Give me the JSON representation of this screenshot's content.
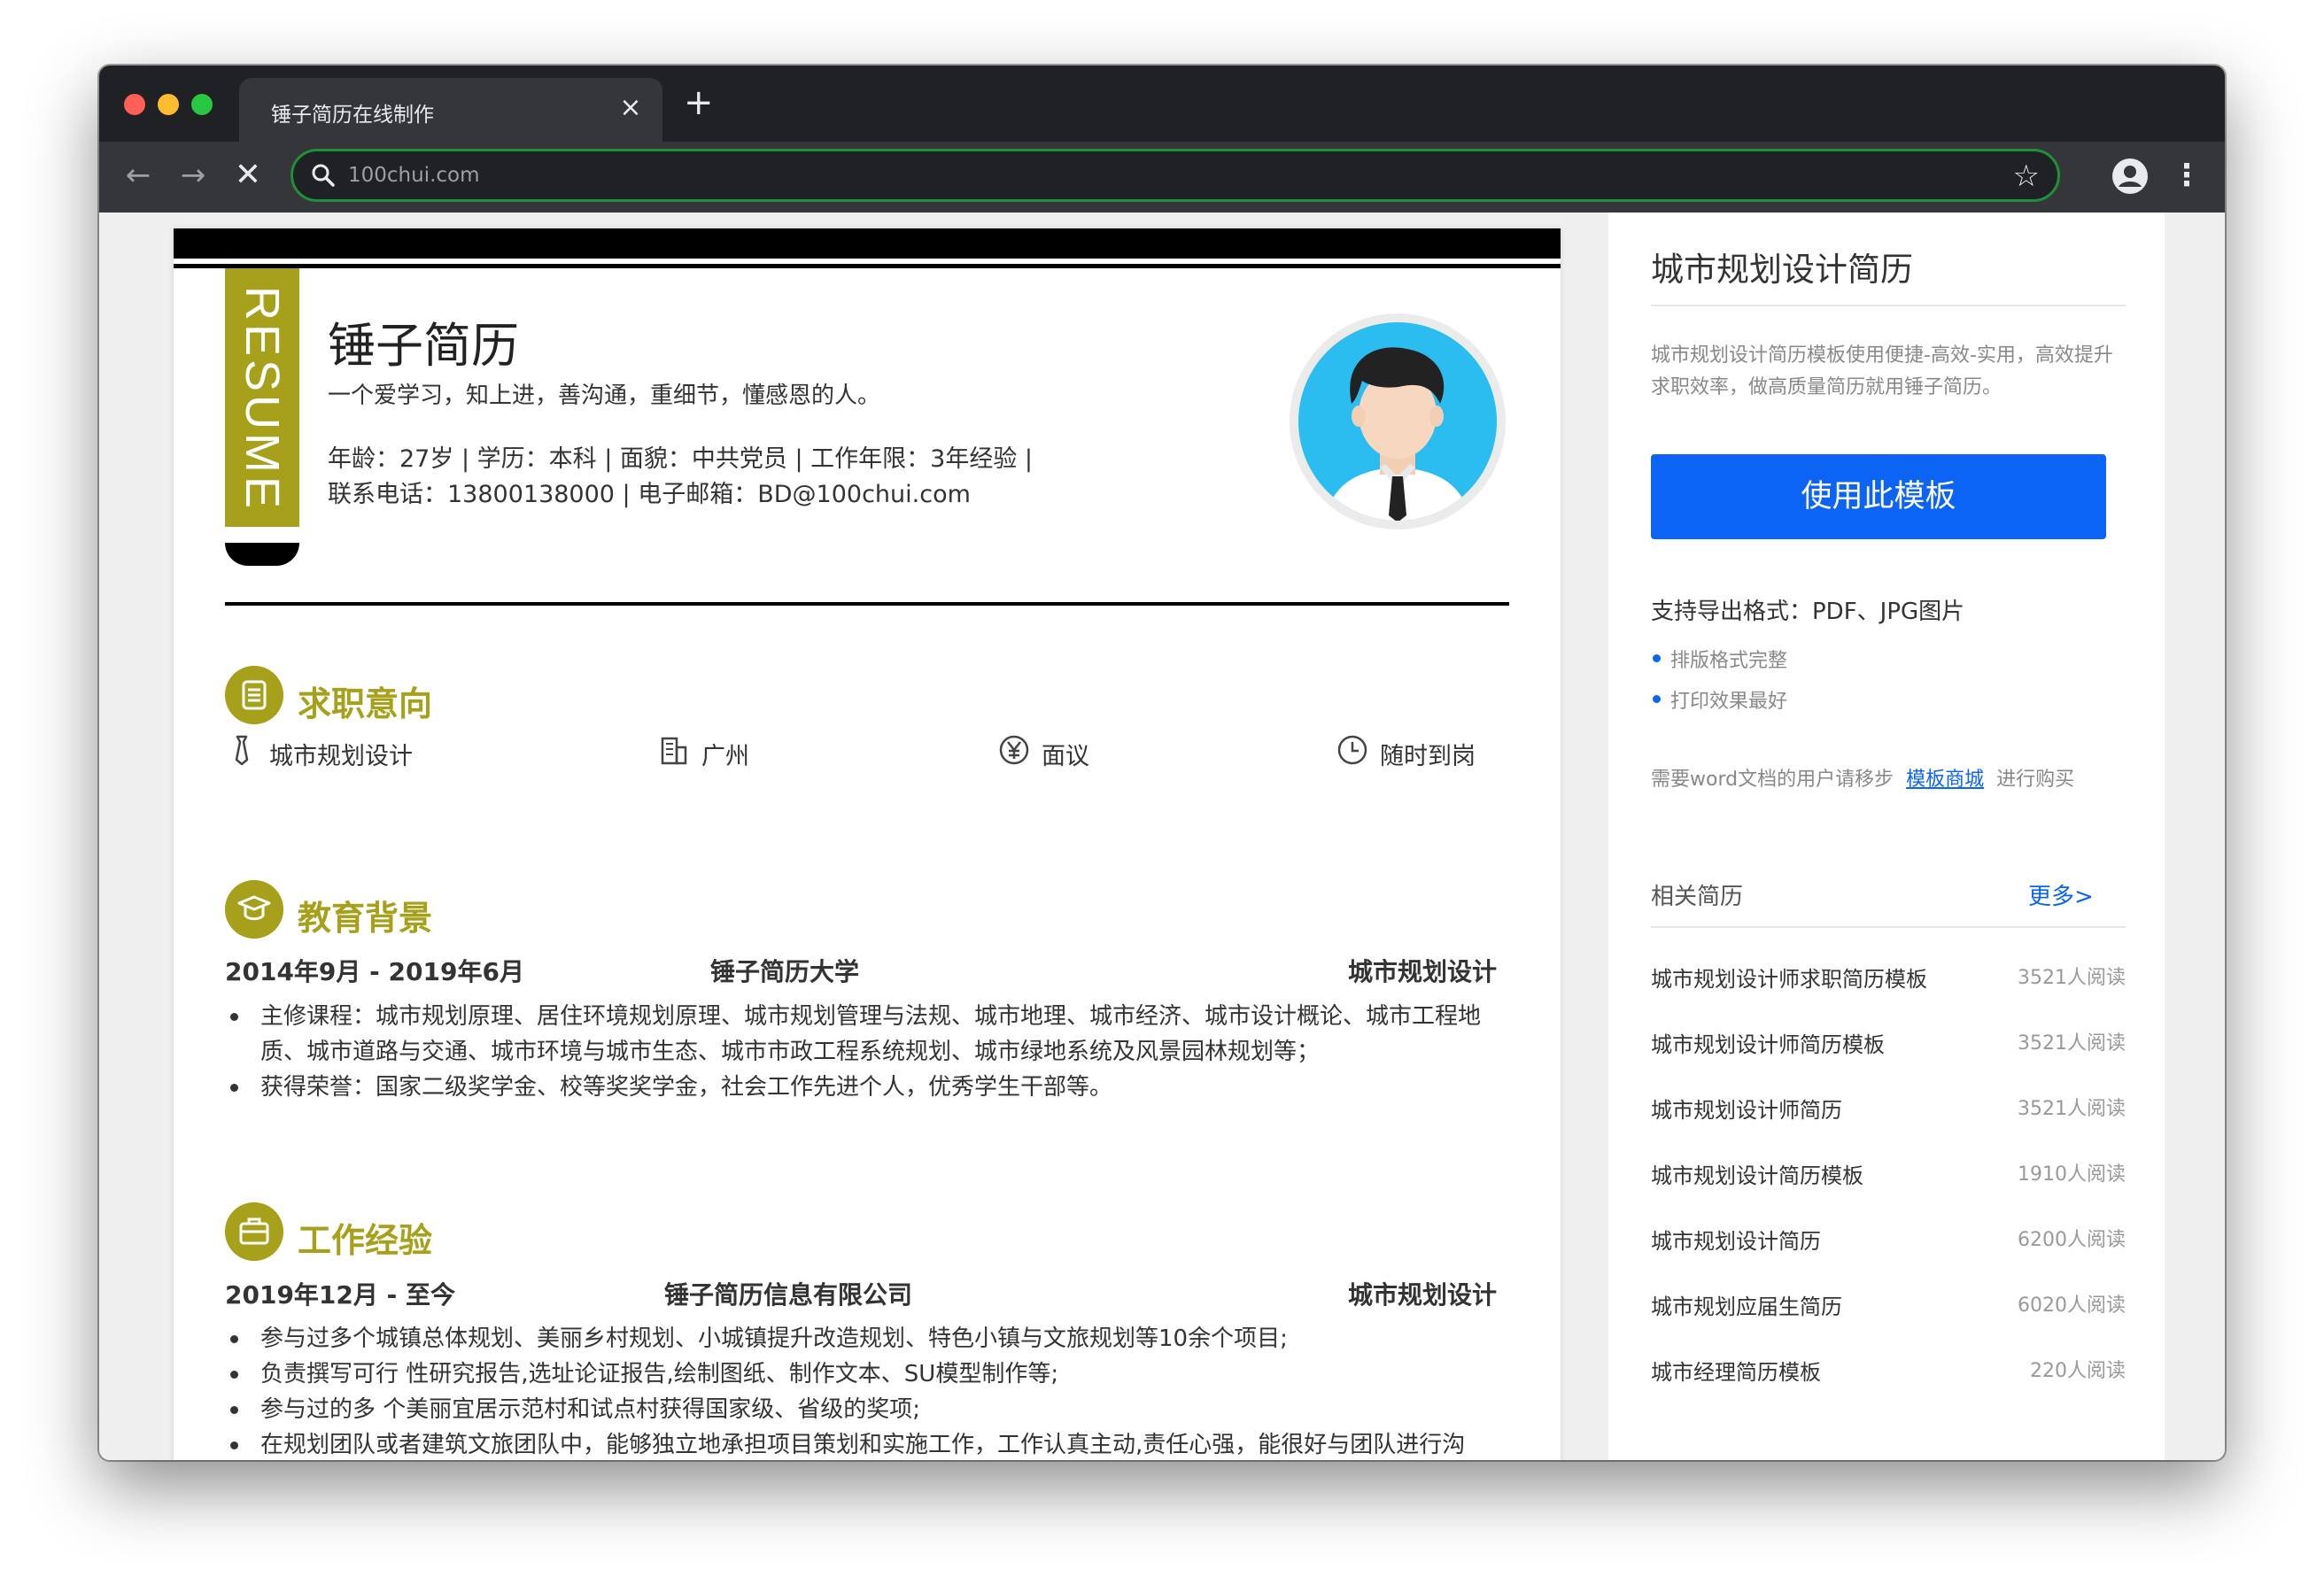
{
  "browser": {
    "tab_title": "锤子简历在线制作",
    "tab_close": "×",
    "new_tab": "+",
    "back": "←",
    "forward": "→",
    "stop": "✕",
    "url": "100chui.com",
    "bookmark": "☆",
    "menu": "⋮",
    "omnibox_border_color": "#1f8f3a"
  },
  "resume": {
    "ribbon": "RESUME",
    "accent_color": "#a6a01a",
    "name": "锤子简历",
    "motto": "一个爱学习，知上进，善沟通，重细节，懂感恩的人。",
    "info_line1": "年龄：27岁 | 学历：本科 | 面貌：中共党员 | 工作年限：3年经验 |",
    "info_line2": "联系电话：13800138000 | 电子邮箱：BD@100chui.com",
    "intent": {
      "title": "求职意向",
      "items": [
        {
          "icon": "tie-icon",
          "label": "城市规划设计"
        },
        {
          "icon": "building-icon",
          "label": "广州"
        },
        {
          "icon": "yen-icon",
          "label": "面议"
        },
        {
          "icon": "clock-icon",
          "label": "随时到岗"
        }
      ]
    },
    "education": {
      "title": "教育背景",
      "period": "2014年9月 - 2019年6月",
      "school": "锤子简历大学",
      "major": "城市规划设计",
      "bullets": [
        "主修课程：城市规划原理、居住环境规划原理、城市规划管理与法规、城市地理、城市经济、城市设计概论、城市工程地质、城市道路与交通、城市环境与城市生态、城市市政工程系统规划、城市绿地系统及风景园林规划等；",
        "获得荣誉：国家二级奖学金、校等奖奖学金，社会工作先进个人，优秀学生干部等。"
      ]
    },
    "work": {
      "title": "工作经验",
      "period": "2019年12月 - 至今",
      "company": "锤子简历信息有限公司",
      "position": "城市规划设计",
      "bullets": [
        "参与过多个城镇总体规划、美丽乡村规划、小城镇提升改造规划、特色小镇与文旅规划等10余个项目;",
        "负责撰写可行 性研究报告,选址论证报告,绘制图纸、制作文本、SU模型制作等;",
        "参与过的多 个美丽宜居示范村和试点村获得国家级、省级的奖项;",
        "在规划团队或者建筑文旅团队中，能够独立地承担项目策划和实施工作，工作认真主动,责任心强，能很好与团队进行沟"
      ]
    }
  },
  "sidebar": {
    "title": "城市规划设计简历",
    "description": "城市规划设计简历模板使用便捷-高效-实用，高效提升求职效率，做高质量简历就用锤子简历。",
    "use_button": "使用此模板",
    "use_button_color": "#0b64f4",
    "export_formats": "支持导出格式：PDF、JPG图片",
    "features": [
      "排版格式完整",
      "打印效果最好"
    ],
    "word_prefix": "需要word文档的用户请移步",
    "word_link": "模板商城",
    "word_suffix": "进行购买",
    "related_title": "相关简历",
    "more": "更多>",
    "related": [
      {
        "title": "城市规划设计师求职简历模板",
        "reads": "3521人阅读"
      },
      {
        "title": "城市规划设计师简历模板",
        "reads": "3521人阅读"
      },
      {
        "title": "城市规划设计师简历",
        "reads": "3521人阅读"
      },
      {
        "title": "城市规划设计简历模板",
        "reads": "1910人阅读"
      },
      {
        "title": "城市规划设计简历",
        "reads": "6200人阅读"
      },
      {
        "title": "城市规划应届生简历",
        "reads": "6020人阅读"
      },
      {
        "title": "城市经理简历模板",
        "reads": "220人阅读"
      }
    ]
  }
}
